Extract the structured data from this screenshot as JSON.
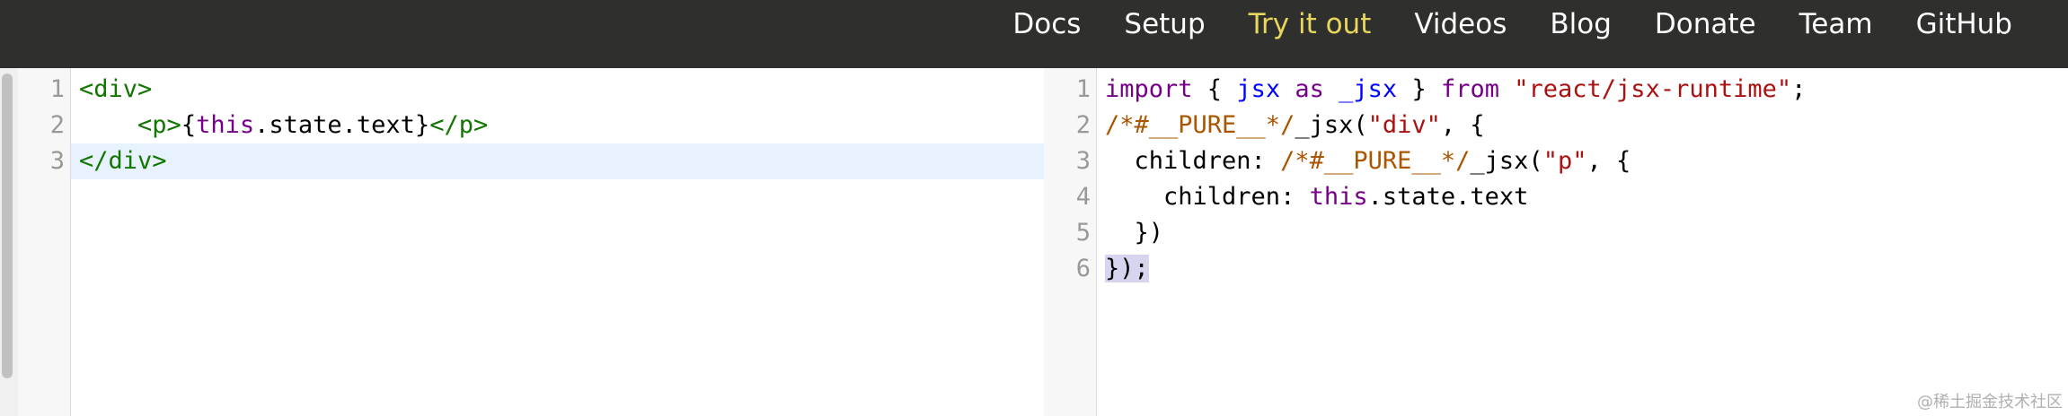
{
  "nav": {
    "links": [
      {
        "label": "Docs"
      },
      {
        "label": "Setup"
      },
      {
        "label": "Try it out"
      },
      {
        "label": "Videos"
      },
      {
        "label": "Blog"
      },
      {
        "label": "Donate"
      },
      {
        "label": "Team"
      },
      {
        "label": "GitHub"
      }
    ],
    "active_color": "#e7d75d"
  },
  "input_editor": {
    "line_numbers": [
      "1",
      "2",
      "3"
    ],
    "lines": [
      [
        {
          "t": "tag",
          "v": "<div>"
        }
      ],
      [
        {
          "t": "plain",
          "v": "    "
        },
        {
          "t": "tag",
          "v": "<p>"
        },
        {
          "t": "punct",
          "v": "{"
        },
        {
          "t": "kw",
          "v": "this"
        },
        {
          "t": "plain",
          "v": ".state.text"
        },
        {
          "t": "punct",
          "v": "}"
        },
        {
          "t": "tag",
          "v": "</p>"
        }
      ],
      [
        {
          "t": "tag",
          "v": "</div>"
        }
      ]
    ]
  },
  "output_editor": {
    "line_numbers": [
      "1",
      "2",
      "3",
      "4",
      "5",
      "6"
    ],
    "lines": [
      [
        {
          "t": "kw",
          "v": "import"
        },
        {
          "t": "plain",
          "v": " { "
        },
        {
          "t": "var",
          "v": "jsx"
        },
        {
          "t": "plain",
          "v": " "
        },
        {
          "t": "kw",
          "v": "as"
        },
        {
          "t": "plain",
          "v": " "
        },
        {
          "t": "var",
          "v": "_jsx"
        },
        {
          "t": "plain",
          "v": " } "
        },
        {
          "t": "kw",
          "v": "from"
        },
        {
          "t": "plain",
          "v": " "
        },
        {
          "t": "str",
          "v": "\"react/jsx-runtime\""
        },
        {
          "t": "plain",
          "v": ";"
        }
      ],
      [
        {
          "t": "cmt",
          "v": "/*#__PURE__*/"
        },
        {
          "t": "plain",
          "v": "_jsx("
        },
        {
          "t": "str",
          "v": "\"div\""
        },
        {
          "t": "plain",
          "v": ", {"
        }
      ],
      [
        {
          "t": "plain",
          "v": "  children: "
        },
        {
          "t": "cmt",
          "v": "/*#__PURE__*/"
        },
        {
          "t": "plain",
          "v": "_jsx("
        },
        {
          "t": "str",
          "v": "\"p\""
        },
        {
          "t": "plain",
          "v": ", {"
        }
      ],
      [
        {
          "t": "plain",
          "v": "    children: "
        },
        {
          "t": "kw",
          "v": "this"
        },
        {
          "t": "plain",
          "v": ".state.text"
        }
      ],
      [
        {
          "t": "plain",
          "v": "  })"
        }
      ],
      [
        {
          "t": "sel",
          "v": "});"
        }
      ]
    ]
  },
  "watermark": "@稀土掘金技术社区"
}
